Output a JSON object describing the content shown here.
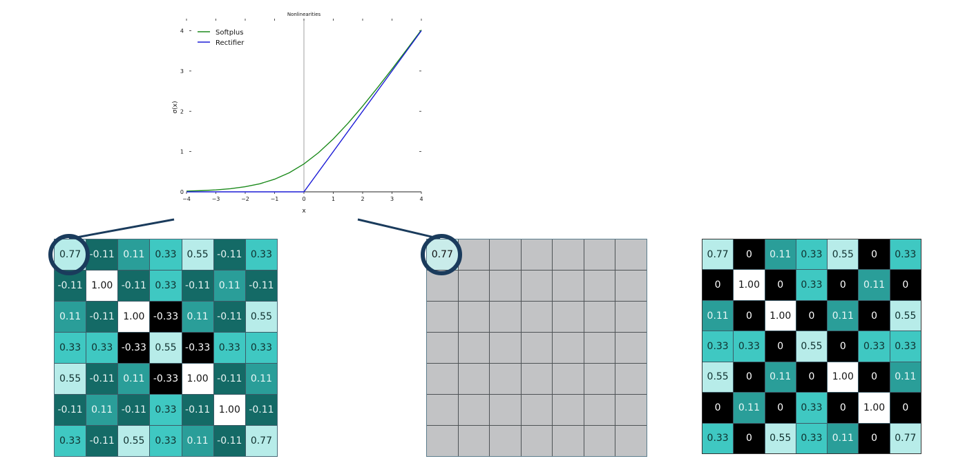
{
  "chart_data": {
    "type": "line",
    "title": "Nonlinearities",
    "xlabel": "x",
    "ylabel": "σ(x)",
    "xlim": [
      -4,
      4
    ],
    "ylim": [
      0,
      4.3
    ],
    "xticks": [
      "−4",
      "−3",
      "−2",
      "−1",
      "0",
      "1",
      "2",
      "3",
      "4"
    ],
    "yticks": [
      "0",
      "1",
      "2",
      "3",
      "4"
    ],
    "legend_position": "top-left",
    "series": [
      {
        "name": "Softplus",
        "color": "#1b8a1b",
        "x": [
          -4,
          -3.5,
          -3,
          -2.5,
          -2,
          -1.5,
          -1,
          -0.5,
          0,
          0.5,
          1,
          1.5,
          2,
          2.5,
          3,
          3.5,
          4
        ],
        "y": [
          0.018,
          0.03,
          0.049,
          0.079,
          0.127,
          0.201,
          0.313,
          0.474,
          0.693,
          0.974,
          1.313,
          1.701,
          2.127,
          2.579,
          3.049,
          3.53,
          4.018
        ]
      },
      {
        "name": "Rectifier",
        "color": "#1c1cd6",
        "x": [
          -4,
          0,
          4
        ],
        "y": [
          0,
          0,
          4
        ]
      }
    ]
  },
  "grids": {
    "left": {
      "values": [
        [
          "0.77",
          "-0.11",
          "0.11",
          "0.33",
          "0.55",
          "-0.11",
          "0.33"
        ],
        [
          "-0.11",
          "1.00",
          "-0.11",
          "0.33",
          "-0.11",
          "0.11",
          "-0.11"
        ],
        [
          "0.11",
          "-0.11",
          "1.00",
          "-0.33",
          "0.11",
          "-0.11",
          "0.55"
        ],
        [
          "0.33",
          "0.33",
          "-0.33",
          "0.55",
          "-0.33",
          "0.33",
          "0.33"
        ],
        [
          "0.55",
          "-0.11",
          "0.11",
          "-0.33",
          "1.00",
          "-0.11",
          "0.11"
        ],
        [
          "-0.11",
          "0.11",
          "-0.11",
          "0.33",
          "-0.11",
          "1.00",
          "-0.11"
        ],
        [
          "0.33",
          "-0.11",
          "0.55",
          "0.33",
          "0.11",
          "-0.11",
          "0.77"
        ]
      ]
    },
    "middle": {
      "values": [
        [
          "0.77",
          "",
          "",
          "",
          "",
          "",
          ""
        ],
        [
          "",
          "",
          "",
          "",
          "",
          "",
          ""
        ],
        [
          "",
          "",
          "",
          "",
          "",
          "",
          ""
        ],
        [
          "",
          "",
          "",
          "",
          "",
          "",
          ""
        ],
        [
          "",
          "",
          "",
          "",
          "",
          "",
          ""
        ],
        [
          "",
          "",
          "",
          "",
          "",
          "",
          ""
        ],
        [
          "",
          "",
          "",
          "",
          "",
          "",
          ""
        ]
      ]
    },
    "right": {
      "values": [
        [
          "0.77",
          "0",
          "0.11",
          "0.33",
          "0.55",
          "0",
          "0.33"
        ],
        [
          "0",
          "1.00",
          "0",
          "0.33",
          "0",
          "0.11",
          "0"
        ],
        [
          "0.11",
          "0",
          "1.00",
          "0",
          "0.11",
          "0",
          "0.55"
        ],
        [
          "0.33",
          "0.33",
          "0",
          "0.55",
          "0",
          "0.33",
          "0.33"
        ],
        [
          "0.55",
          "0",
          "0.11",
          "0",
          "1.00",
          "0",
          "0.11"
        ],
        [
          "0",
          "0.11",
          "0",
          "0.33",
          "0",
          "1.00",
          "0"
        ],
        [
          "0.33",
          "0",
          "0.55",
          "0.33",
          "0.11",
          "0",
          "0.77"
        ]
      ]
    }
  },
  "colors": {
    "circle": "#1a3b5c",
    "connector": "#1a3b5c"
  }
}
